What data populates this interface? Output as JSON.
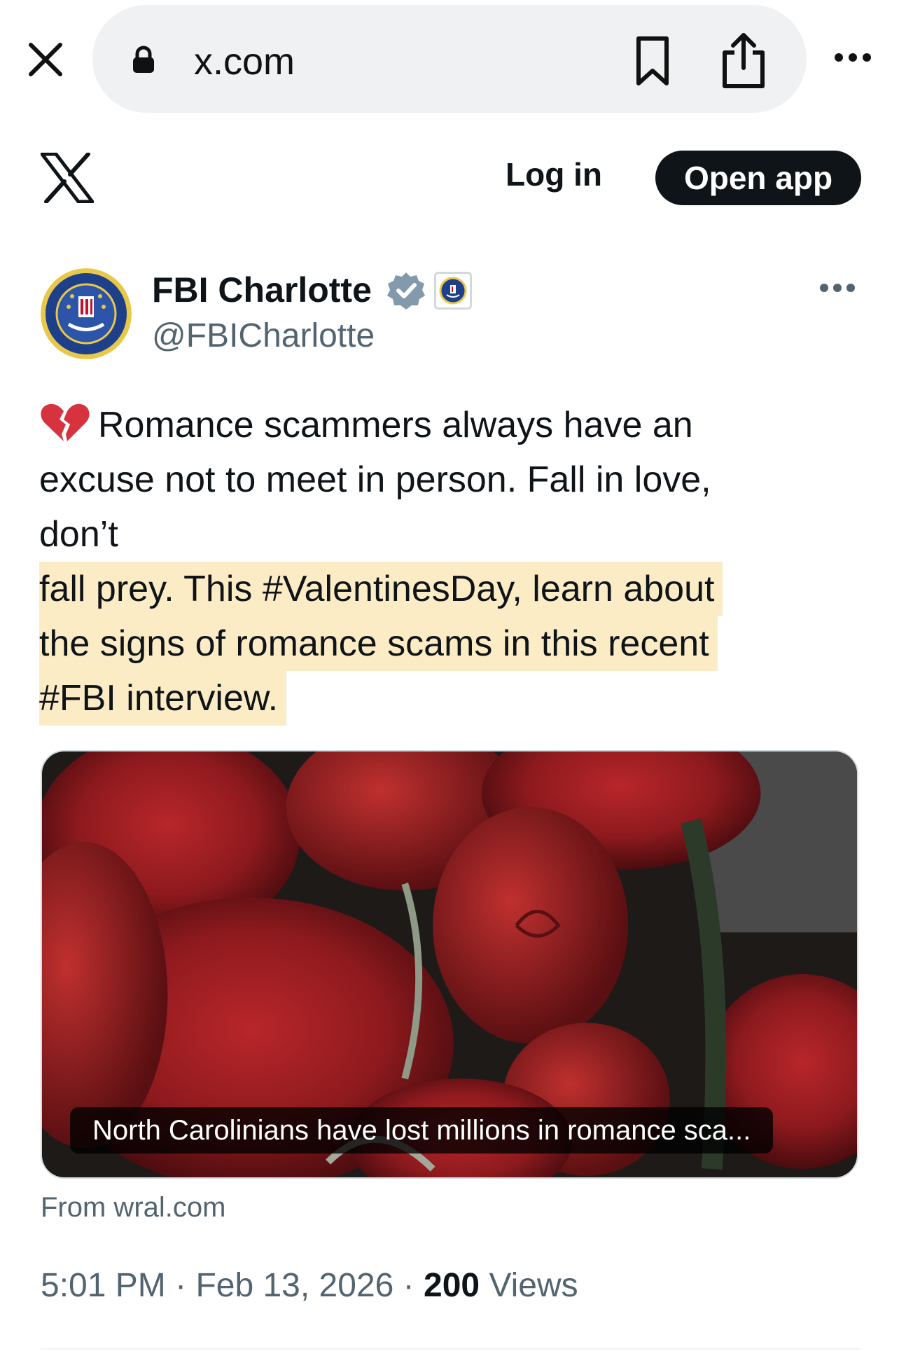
{
  "browser": {
    "url": "x.com",
    "icons": {
      "close": "close-icon",
      "lock": "lock-icon",
      "bookmark": "bookmark-icon",
      "share": "share-icon",
      "more": "more-horizontal-icon"
    }
  },
  "header": {
    "logo": "x-logo-icon",
    "login_label": "Log in",
    "open_app_label": "Open app"
  },
  "post": {
    "author": {
      "name": "FBI Charlotte",
      "handle": "@FBICharlotte",
      "verified": true,
      "badges": [
        "verified-icon",
        "fbi-seal-affiliate-badge"
      ]
    },
    "text_lines": [
      "Romance scammers always have an",
      "excuse not to meet in person. Fall in love,",
      "don’t",
      "fall prey. This #ValentinesDay, learn about",
      "the signs of romance scams in this recent",
      "#FBI interview."
    ],
    "leading_emoji": "broken-heart-icon",
    "highlight_color": "#fcecc5",
    "card": {
      "image": "red-roses-photo",
      "caption": "North Carolinians have lost millions in romance sca...",
      "source": "From wral.com"
    },
    "meta": {
      "time": "5:01 PM",
      "separator": "·",
      "date": "Feb 13, 2026",
      "views_count": "200",
      "views_label": "Views"
    }
  },
  "colors": {
    "text_primary": "#0f1419",
    "text_secondary": "#536471",
    "verified_badge": "#829aab",
    "button_dark": "#0f1419",
    "url_pill": "#f0f1f3"
  }
}
